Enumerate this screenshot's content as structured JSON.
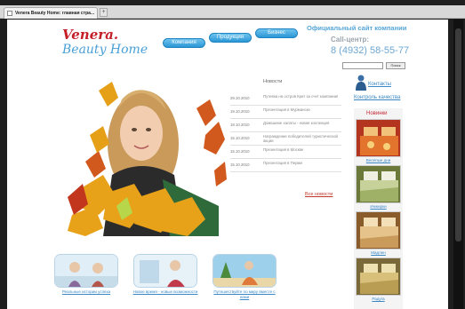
{
  "browser": {
    "tab_title": "Venera Beauty Home: главная стра...",
    "new_tab_label": "+"
  },
  "logo": {
    "line1": "Venera.",
    "line2": "Beauty Home"
  },
  "nav": {
    "items": [
      "Компания",
      "Продукция",
      "Бизнес"
    ]
  },
  "header": {
    "site_title": "Официальный сайт компании",
    "call_center": "Call-центр:",
    "phone": "8 (4932) 58-55-77"
  },
  "search": {
    "button_label": "Поиск",
    "placeholder": ""
  },
  "news": {
    "heading": "Новости",
    "items": [
      {
        "date": "29.10.2010",
        "title": "Путевка на остров Крит за счет компании!"
      },
      {
        "date": "19.10.2010",
        "title": "Презентация в Мурманске"
      },
      {
        "date": "18.10.2010",
        "title": "Домашние халаты - новая коллекция"
      },
      {
        "date": "15.10.2010",
        "title": "Награждение победителей туристической акции"
      },
      {
        "date": "15.10.2010",
        "title": "Презентация в Москве"
      },
      {
        "date": "15.10.2010",
        "title": "Презентация в Перми"
      }
    ],
    "all_link": "Все новости"
  },
  "sidebar": {
    "contacts": "Контакты",
    "quality": "Контроль качества",
    "novelties_title": "Новинки",
    "products": [
      "Весёлые дни",
      "Инжирки",
      "Мадлен",
      "Радуга"
    ]
  },
  "bottom": {
    "captions": [
      "Реальные истории успеха",
      "Новое время - новые возможности",
      "Путешествуйте по миру вместе с нами"
    ]
  },
  "colors": {
    "brand_red": "#c51f28",
    "brand_blue": "#4aa0d6",
    "nav_blue": "#2a96d4",
    "link_blue": "#3a88c6",
    "news_red": "#c0392b"
  }
}
